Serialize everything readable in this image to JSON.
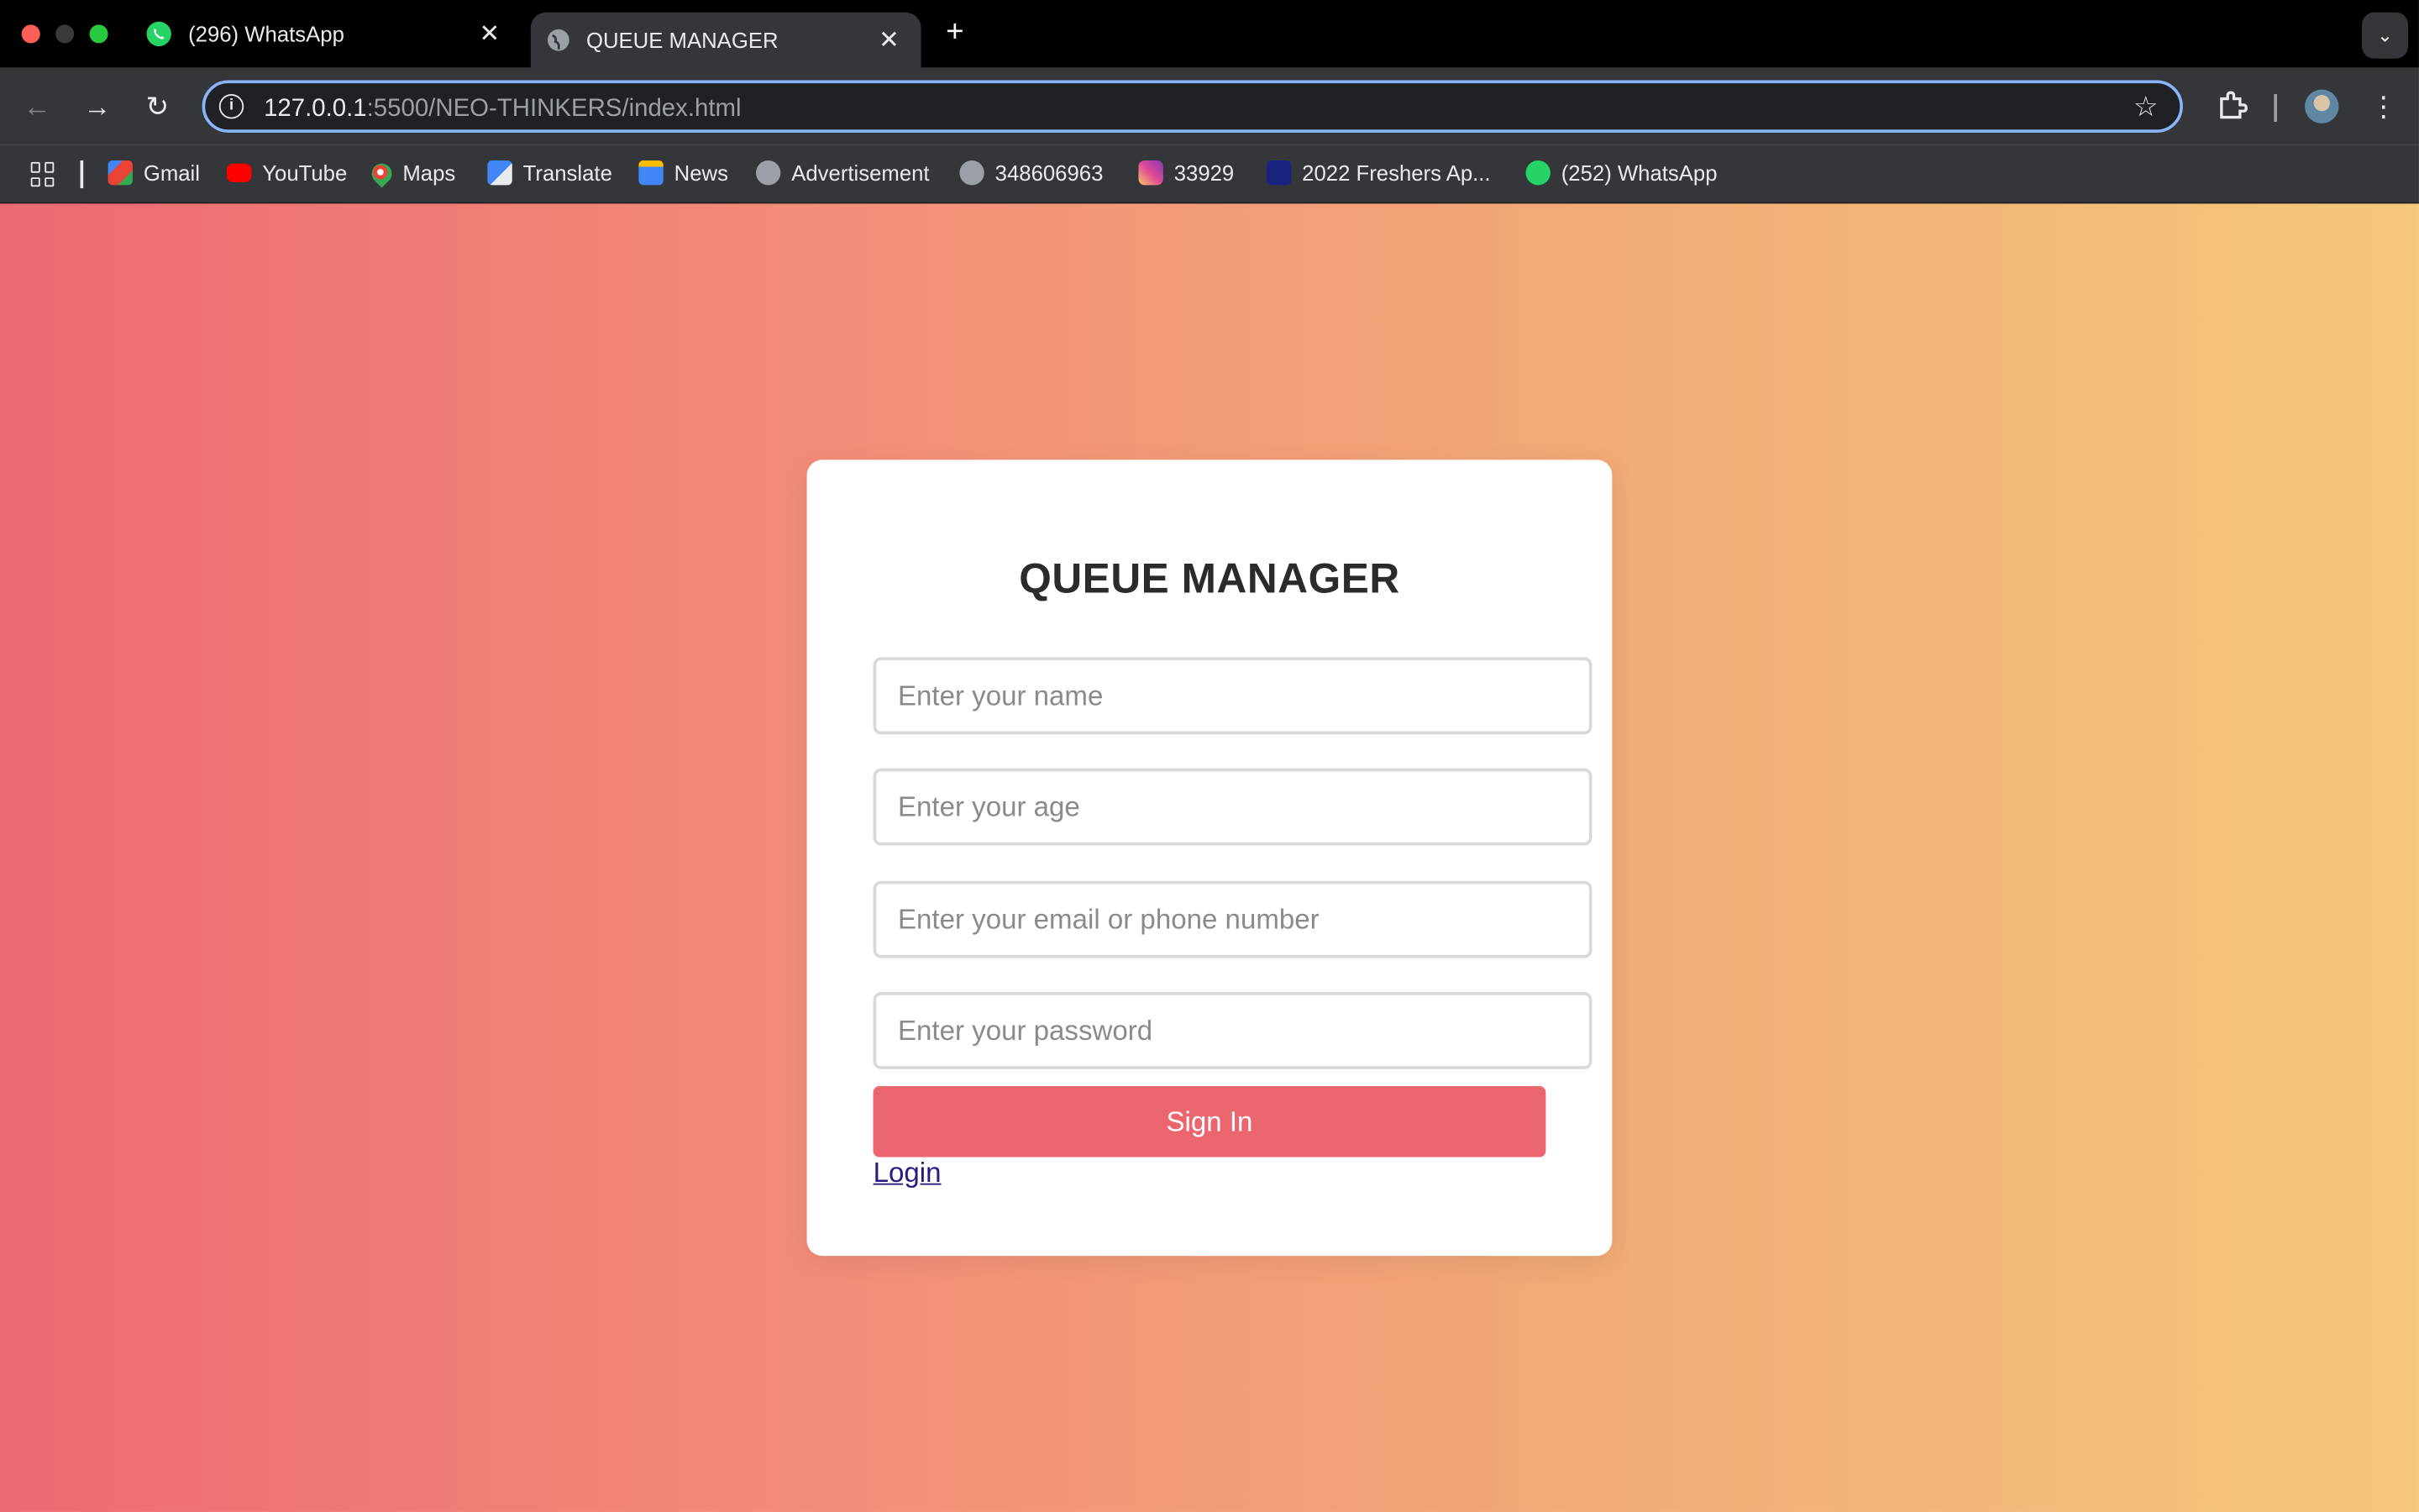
{
  "browser": {
    "tabs": [
      {
        "title": "(296) WhatsApp",
        "icon": "whatsapp-icon",
        "active": false
      },
      {
        "title": "QUEUE MANAGER",
        "icon": "globe-icon",
        "active": true
      }
    ],
    "url_host": "127.0.0.1",
    "url_rest": ":5500/NEO-THINKERS/index.html",
    "bookmarks": [
      {
        "label": "Gmail",
        "icon": "gmail-icon",
        "color": "#ea4335"
      },
      {
        "label": "YouTube",
        "icon": "youtube-icon",
        "color": "#ff0000"
      },
      {
        "label": "Maps",
        "icon": "maps-icon",
        "color": "#34a853"
      },
      {
        "label": "Translate",
        "icon": "translate-icon",
        "color": "#4285f4"
      },
      {
        "label": "News",
        "icon": "news-icon",
        "color": "#4285f4"
      },
      {
        "label": "Advertisement",
        "icon": "globe-icon",
        "color": "#9aa0a6"
      },
      {
        "label": "348606963",
        "icon": "globe-icon",
        "color": "#9aa0a6"
      },
      {
        "label": "33929",
        "icon": "instagram-icon",
        "color": "#e1306c"
      },
      {
        "label": "2022 Freshers Ap...",
        "icon": "site-icon",
        "color": "#1a237e"
      },
      {
        "label": "(252) WhatsApp",
        "icon": "whatsapp-icon",
        "color": "#25d366"
      }
    ]
  },
  "form": {
    "title": "QUEUE MANAGER",
    "name_placeholder": "Enter your name",
    "age_placeholder": "Enter your age",
    "contact_placeholder": "Enter your email or phone number",
    "password_placeholder": "Enter your password",
    "signin_label": "Sign In",
    "login_link": "Login"
  }
}
